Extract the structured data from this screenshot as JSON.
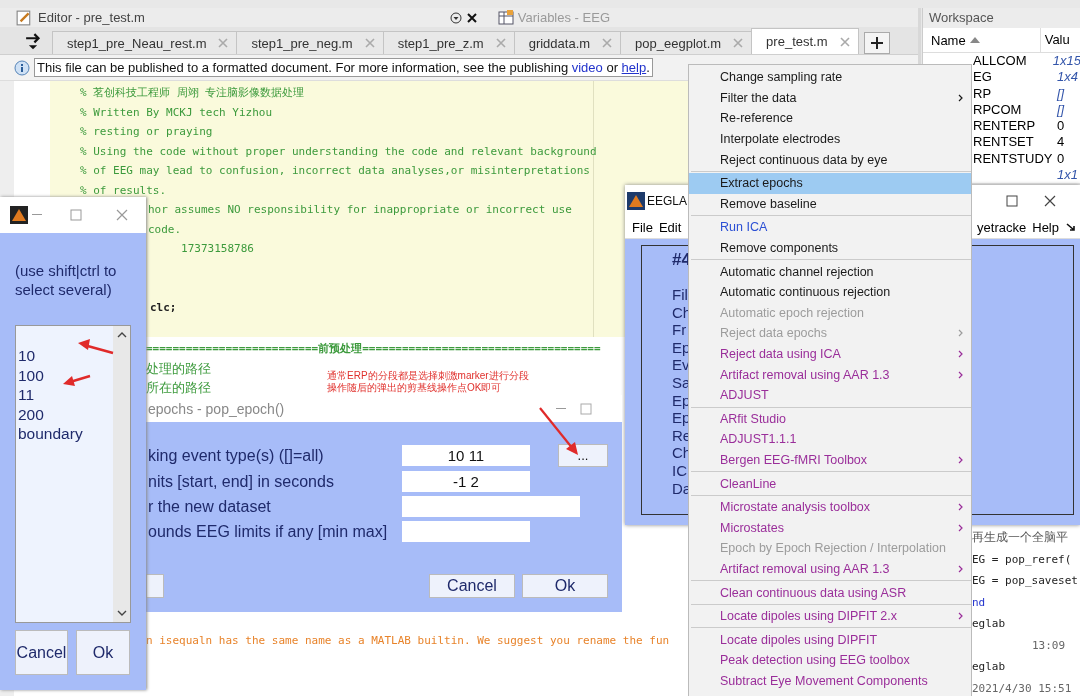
{
  "editor": {
    "title": "Editor - pre_test.m",
    "docked_title": "Variables - EEG",
    "tabs": [
      {
        "label": "step1_pre_Neau_rest.m",
        "selected": false
      },
      {
        "label": "step1_pre_neg.m",
        "selected": false
      },
      {
        "label": "step1_pre_z.m",
        "selected": false
      },
      {
        "label": "griddata.m",
        "selected": false
      },
      {
        "label": "pop_eegplot.m",
        "selected": false
      },
      {
        "label": "pre_test.m",
        "selected": true
      }
    ],
    "info_bar": {
      "text": "This file can be published to a formatted document. For more information, see the publishing ",
      "link_1": "video",
      "between": " or ",
      "link_2": "help",
      "end": "."
    },
    "code_lines": [
      {
        "kind": "comment",
        "text": "% 茗创科技工程师 周翊 专注脑影像数据处理"
      },
      {
        "kind": "comment",
        "text": "% Written By MCKJ tech Yizhou"
      },
      {
        "kind": "comment",
        "text": "% resting or praying"
      },
      {
        "kind": "comment",
        "text": "% Using the code without proper understanding the code and relevant background"
      },
      {
        "kind": "comment",
        "text": "% of EEG may lead to confusion, incorrect data analyses,or misinterpretations"
      },
      {
        "kind": "comment",
        "text": "% of results."
      },
      {
        "kind": "covered_comment",
        "text": "hor assumes NO responsibility for inappropriate or incorrect use"
      },
      {
        "kind": "covered_comment",
        "text": "code."
      },
      {
        "kind": "covered_comment",
        "text": "     17373158786"
      },
      {
        "kind": "blank"
      },
      {
        "kind": "blank"
      },
      {
        "kind": "covered_code",
        "text": "clc;"
      }
    ],
    "section_lines": [
      {
        "kind": "section",
        "text": "==========================前预处理===================================="
      },
      {
        "kind": "comment",
        "text": "处理的路径"
      },
      {
        "kind": "comment",
        "text": "所在的路径"
      }
    ],
    "warning": "n isequaln has the same name as a MATLAB builtin. We suggest you rename the fun"
  },
  "annotation": [
    "通常ERP的分段都是选择刺激marker进行分段",
    "操作随后的弹出的剪基线操作点OK即可"
  ],
  "event_picker": {
    "hint": "(use shift|ctrl to select several)",
    "items": [
      "10",
      "100",
      "11",
      "200",
      "boundary"
    ],
    "buttons": [
      "Cancel",
      "Ok"
    ]
  },
  "epoch_dialog": {
    "title": "epochs - pop_epoch()",
    "rows": [
      {
        "kind": "browse",
        "label": "king event type(s) ([]=all)",
        "value": "10 11",
        "browse": "..."
      },
      {
        "kind": "short",
        "label": "nits [start, end] in seconds",
        "value": "-1 2"
      },
      {
        "kind": "wide",
        "label": "r the new dataset",
        "value": ""
      },
      {
        "kind": "short",
        "label": "ounds EEG limits if any [min max]",
        "value": ""
      }
    ],
    "buttons": [
      "Cancel",
      "Ok"
    ]
  },
  "eeglab": {
    "title": "EEGLA",
    "menus_left": [
      "File",
      "Edit"
    ],
    "menus_right": [
      "yetracke",
      "Help"
    ],
    "heading": "#4",
    "labels": [
      "Fil",
      "Ch",
      "Fr",
      "Ep",
      "Ev",
      "Sa",
      "Ep",
      "Ep",
      "Re",
      "Ch",
      "IC",
      "Da"
    ]
  },
  "workspace": {
    "title": "Workspace",
    "columns": [
      "Name",
      "Valu"
    ],
    "rows": [
      {
        "name": "ALLCOM",
        "value": "1x15",
        "kind": "size"
      },
      {
        "name": "EG",
        "value": "1x4",
        "kind": "size"
      },
      {
        "name": "RP",
        "value": "[]",
        "kind": "size"
      },
      {
        "name": "RPCOM",
        "value": "[]",
        "kind": "size"
      },
      {
        "name": "RENTERP",
        "value": "0",
        "kind": "number"
      },
      {
        "name": "RENTSET",
        "value": "4",
        "kind": "number"
      },
      {
        "name": "RENTSTUDY",
        "value": "0",
        "kind": "number"
      },
      {
        "name": "",
        "value": "1x1",
        "kind": "size"
      }
    ]
  },
  "command_lines": [
    {
      "kind": "comment",
      "text": "再生成一个全脑平"
    },
    {
      "kind": "code",
      "text": "EG = pop_reref( "
    },
    {
      "kind": "code",
      "text": "EG = pop_saveset"
    },
    {
      "kind": "keyword",
      "text": "nd"
    },
    {
      "kind": "code",
      "text": "eglab"
    },
    {
      "kind": "time",
      "text": "13:09"
    },
    {
      "kind": "code",
      "text": "eglab"
    },
    {
      "kind": "date",
      "text": "2021/4/30 15:51"
    }
  ],
  "context_menu": {
    "groups": [
      [
        {
          "label": "Change sampling rate",
          "kind": "normal",
          "selected": false,
          "submenu": false
        },
        {
          "label": "Filter the data",
          "kind": "normal",
          "selected": false,
          "submenu": true
        },
        {
          "label": "Re-reference",
          "kind": "normal",
          "selected": false,
          "submenu": false
        },
        {
          "label": "Interpolate electrodes",
          "kind": "normal",
          "selected": false,
          "submenu": false
        },
        {
          "label": "Reject continuous data by eye",
          "kind": "normal",
          "selected": false,
          "submenu": false
        }
      ],
      [
        {
          "label": "Extract epochs",
          "kind": "normal",
          "selected": true,
          "submenu": false
        },
        {
          "label": "Remove baseline",
          "kind": "normal",
          "selected": false,
          "submenu": false
        }
      ],
      [
        {
          "label": "Run ICA",
          "kind": "link",
          "selected": false,
          "submenu": false
        },
        {
          "label": "Remove components",
          "kind": "normal",
          "selected": false,
          "submenu": false
        }
      ],
      [
        {
          "label": "Automatic channel rejection",
          "kind": "normal",
          "selected": false,
          "submenu": false
        },
        {
          "label": "Automatic continuous rejection",
          "kind": "normal",
          "selected": false,
          "submenu": false
        },
        {
          "label": "Automatic epoch rejection",
          "kind": "disabled",
          "selected": false,
          "submenu": false
        },
        {
          "label": "Reject data epochs",
          "kind": "disabled",
          "selected": false,
          "submenu": true
        },
        {
          "label": "Reject data using ICA",
          "kind": "plugin",
          "selected": false,
          "submenu": true
        },
        {
          "label": "Artifact removal using AAR 1.3",
          "kind": "plugin",
          "selected": false,
          "submenu": true
        },
        {
          "label": "ADJUST",
          "kind": "plugin",
          "selected": false,
          "submenu": false
        }
      ],
      [
        {
          "label": "ARfit Studio",
          "kind": "plugin",
          "selected": false,
          "submenu": false
        },
        {
          "label": "ADJUST1.1.1",
          "kind": "plugin",
          "selected": false,
          "submenu": false
        },
        {
          "label": "Bergen EEG-fMRI Toolbox",
          "kind": "plugin",
          "selected": false,
          "submenu": true
        }
      ],
      [
        {
          "label": "CleanLine",
          "kind": "plugin",
          "selected": false,
          "submenu": false
        }
      ],
      [
        {
          "label": "Microstate analysis toolbox",
          "kind": "plugin",
          "selected": false,
          "submenu": true
        },
        {
          "label": "Microstates",
          "kind": "plugin",
          "selected": false,
          "submenu": true
        },
        {
          "label": "Epoch by Epoch Rejection / Interpolation",
          "kind": "disabled",
          "selected": false,
          "submenu": false
        },
        {
          "label": "Artifact removal using AAR 1.3",
          "kind": "plugin",
          "selected": false,
          "submenu": true
        }
      ],
      [
        {
          "label": "Clean continuous data using ASR",
          "kind": "plugin",
          "selected": false,
          "submenu": false
        }
      ],
      [
        {
          "label": "Locate dipoles using DIPFIT 2.x",
          "kind": "plugin",
          "selected": false,
          "submenu": true
        }
      ],
      [
        {
          "label": "Locate dipoles using DIPFIT",
          "kind": "plugin",
          "selected": false,
          "submenu": false
        },
        {
          "label": "Peak detection using EEG toolbox",
          "kind": "plugin",
          "selected": false,
          "submenu": false
        },
        {
          "label": "Subtract Eye Movement Components",
          "kind": "plugin",
          "selected": false,
          "submenu": false
        }
      ]
    ]
  }
}
